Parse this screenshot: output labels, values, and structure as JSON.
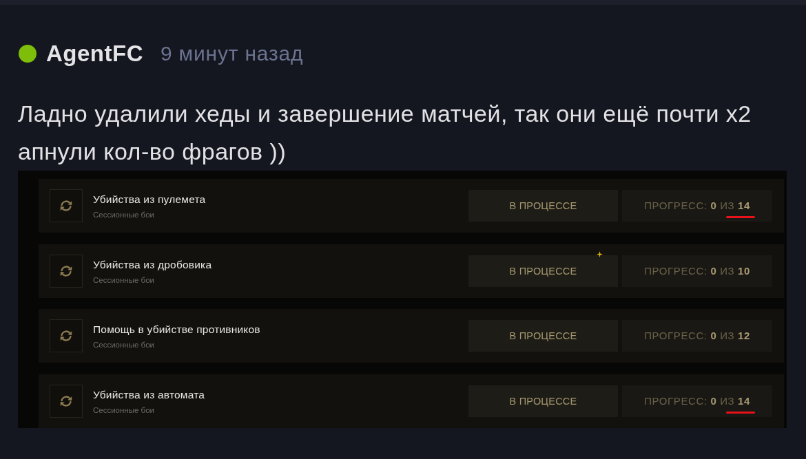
{
  "post": {
    "author": {
      "name": "AgentFC",
      "online": true
    },
    "time": "9 минут назад",
    "text": "Ладно удалили хеды и завершение матчей, так они ещё почти x2 апнули кол-во фрагов ))",
    "screenshot": {
      "tasks": [
        {
          "title": "Убийства из пулемета",
          "subtitle": "Сессионные бои",
          "status": "В ПРОЦЕССЕ",
          "progress": "ПРОГРЕСС: **0** ИЗ **14**",
          "total_underlined": true
        },
        {
          "title": "Убийства из дробовика",
          "subtitle": "Сессионные бои",
          "status": "В ПРОЦЕССЕ",
          "progress": "ПРОГРЕСС: **0** ИЗ **10**",
          "total_underlined": false
        },
        {
          "title": "Помощь в убийстве противников",
          "subtitle": "Сессионные бои",
          "status": "В ПРОЦЕССЕ",
          "progress": "ПРОГРЕСС: **0** ИЗ **12**",
          "total_underlined": false
        },
        {
          "title": "Убийства из автомата",
          "subtitle": "Сессионные бои",
          "status": "В ПРОЦЕССЕ",
          "progress": "ПРОГРЕСС: **0** ИЗ **14**",
          "total_underlined": true
        }
      ]
    }
  }
}
